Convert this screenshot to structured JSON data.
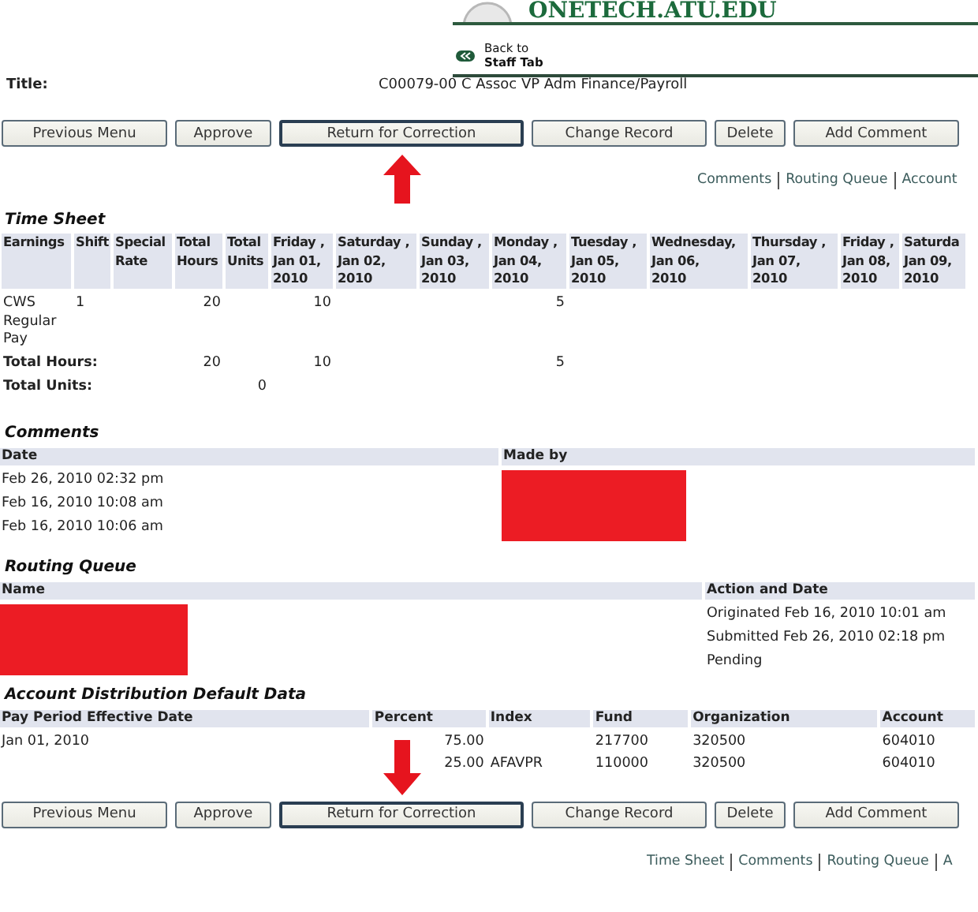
{
  "header": {
    "logo": "ONETECH.ATU.EDU",
    "back_link": {
      "line1": "Back to",
      "line2": "Staff Tab"
    }
  },
  "title_row": {
    "label": "Title:",
    "value": "C00079-00 C Assoc VP Adm Finance/Payroll"
  },
  "top_actions": {
    "buttons": [
      {
        "label": "Previous Menu",
        "focused": false,
        "marked": false
      },
      {
        "label": "Approve",
        "focused": false,
        "marked": false
      },
      {
        "label": "Return for Correction",
        "focused": true,
        "marked": true
      },
      {
        "label": "Change Record",
        "focused": false,
        "marked": false
      },
      {
        "label": "Delete",
        "focused": false,
        "marked": false
      },
      {
        "label": "Add Comment",
        "focused": false,
        "marked": false
      }
    ],
    "links": [
      "Comments",
      "Routing Queue",
      "Account"
    ]
  },
  "timesheet": {
    "title": "Time Sheet",
    "columns": [
      "Earnings",
      "Shift",
      "Special\nRate",
      "Total\nHours",
      "Total\nUnits",
      "Friday ,\nJan 01,\n2010",
      "Saturday ,\nJan 02,\n2010",
      "Sunday ,\nJan 03,\n2010",
      "Monday ,\nJan 04,\n2010",
      "Tuesday ,\nJan 05,\n2010",
      "Wednesday,\nJan 06,\n2010",
      "Thursday ,\nJan 07,\n2010",
      "Friday ,\nJan 08,\n2010",
      "Saturda\nJan 09,\n2010"
    ],
    "rows": [
      {
        "kind": "entry",
        "cells": [
          "CWS Regular Pay",
          "1",
          null,
          "20",
          null,
          "10",
          null,
          null,
          "5",
          null,
          null,
          null,
          null,
          null
        ]
      },
      {
        "kind": "total",
        "cells": [
          "Total Hours:",
          null,
          null,
          "20",
          null,
          "10",
          null,
          null,
          "5",
          null,
          null,
          null,
          null,
          null
        ]
      },
      {
        "kind": "total",
        "cells": [
          "Total Units:",
          null,
          null,
          null,
          "0",
          null,
          null,
          null,
          null,
          null,
          null,
          null,
          null,
          null
        ]
      }
    ]
  },
  "comments": {
    "title": "Comments",
    "redacted": true,
    "columns": [
      "Date",
      "Made by"
    ],
    "rows": [
      {
        "cells": [
          "Feb 26, 2010 02:32 pm",
          null
        ]
      },
      {
        "cells": [
          "Feb 16, 2010 10:08 am",
          null
        ]
      },
      {
        "cells": [
          "Feb 16, 2010 10:06 am",
          null
        ]
      }
    ]
  },
  "routing_queue": {
    "title": "Routing Queue",
    "redacted": true,
    "columns": [
      "Name",
      "Action and Date"
    ],
    "rows": [
      {
        "cells": [
          null,
          "Originated Feb 16, 2010 10:01 am"
        ]
      },
      {
        "cells": [
          null,
          "Submitted Feb 26, 2010 02:18 pm"
        ]
      },
      {
        "cells": [
          null,
          "Pending"
        ]
      }
    ]
  },
  "account_distribution": {
    "title": "Account Distribution Default Data",
    "columns": [
      "Pay Period Effective Date",
      "Percent",
      "Index",
      "Fund",
      "Organization",
      "Account"
    ],
    "rows": [
      {
        "cells": [
          "Jan 01, 2010",
          "75.00",
          null,
          "217700",
          "320500",
          "604010"
        ]
      },
      {
        "cells": [
          null,
          "25.00",
          "AFAVPR",
          "110000",
          "320500",
          "604010"
        ]
      }
    ]
  },
  "bottom_actions": {
    "buttons": [
      {
        "label": "Previous Menu",
        "focused": false,
        "marked": false
      },
      {
        "label": "Approve",
        "focused": false,
        "marked": false
      },
      {
        "label": "Return for Correction",
        "focused": true,
        "marked": true
      },
      {
        "label": "Change Record",
        "focused": false,
        "marked": false
      },
      {
        "label": "Delete",
        "focused": false,
        "marked": false
      },
      {
        "label": "Add Comment",
        "focused": false,
        "marked": false
      }
    ],
    "links": [
      "Time Sheet",
      "Comments",
      "Routing Queue",
      "A"
    ]
  }
}
